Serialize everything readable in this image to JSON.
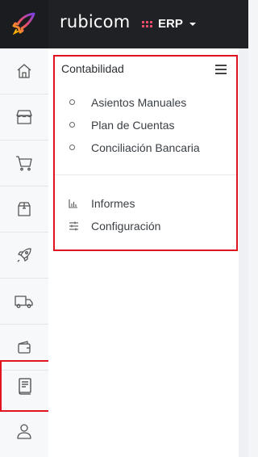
{
  "header": {
    "brand": "rubicom",
    "product": "ERP",
    "logo_icon": "rocket-logo-icon",
    "accent_color": "#e94b6a"
  },
  "sidebar": {
    "items": [
      {
        "icon": "home-icon"
      },
      {
        "icon": "store-icon"
      },
      {
        "icon": "cart-icon"
      },
      {
        "icon": "box-icon"
      },
      {
        "icon": "rocket-icon"
      },
      {
        "icon": "truck-icon"
      },
      {
        "icon": "wallet-icon"
      },
      {
        "icon": "ledger-book-icon",
        "active": true
      },
      {
        "icon": "user-icon"
      }
    ]
  },
  "menu": {
    "title": "Contabilidad",
    "items": [
      {
        "label": "Asientos Manuales"
      },
      {
        "label": "Plan de Cuentas"
      },
      {
        "label": "Conciliación Bancaria"
      }
    ],
    "footer_items": [
      {
        "label": "Informes",
        "icon": "bar-chart-icon"
      },
      {
        "label": "Configuración",
        "icon": "sliders-icon"
      }
    ]
  },
  "colors": {
    "topbar": "#202124",
    "highlight": "#e0141e"
  }
}
